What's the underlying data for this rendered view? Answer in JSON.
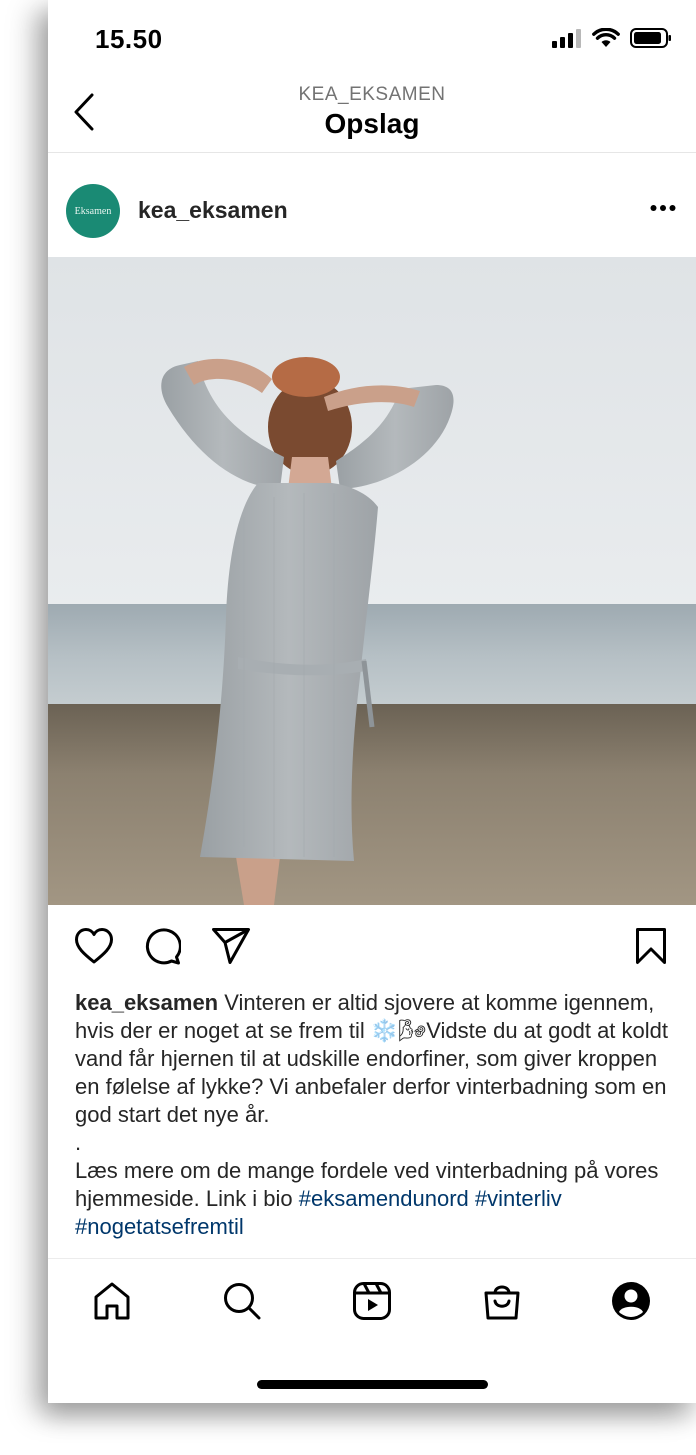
{
  "status_bar": {
    "time": "15.50",
    "icons": [
      "signal-icon",
      "wifi-icon",
      "battery-icon"
    ]
  },
  "header": {
    "subtitle": "KEA_EKSAMEN",
    "title": "Opslag",
    "back_icon": "chevron-left-icon"
  },
  "post": {
    "avatar_text": "Eksamen",
    "avatar_color": "#1a8a74",
    "username": "kea_eksamen",
    "more_icon": "ellipsis-icon",
    "image_description_icon": "photo",
    "actions": [
      "heart-icon",
      "comment-icon",
      "share-icon",
      "bookmark-icon"
    ],
    "caption": {
      "username": "kea_eksamen",
      "text_1": "Vinteren er altid sjovere at komme igennem, hvis der er noget at se frem til ",
      "emoji": "❄️🌬",
      "text_2": "Vidste du at godt at koldt vand får hjernen til at udskille endorfiner, som giver kroppen en følelse af lykke? Vi anbefaler derfor vinterbadning som en god start det nye år.",
      "dot": ".",
      "text_3": "Læs mere om de mange fordele ved vinterbadning på vores hjemmeside. Link i bio ",
      "hashtags": [
        "#eksamendunord",
        "#vinterliv",
        "#nogetatsefremtil"
      ]
    }
  },
  "tab_bar": {
    "items": [
      "home-icon",
      "search-icon",
      "reels-icon",
      "shop-icon",
      "profile-icon"
    ]
  },
  "colors": {
    "hashtag": "#00376b",
    "text": "#262626",
    "secondary": "#737373"
  }
}
